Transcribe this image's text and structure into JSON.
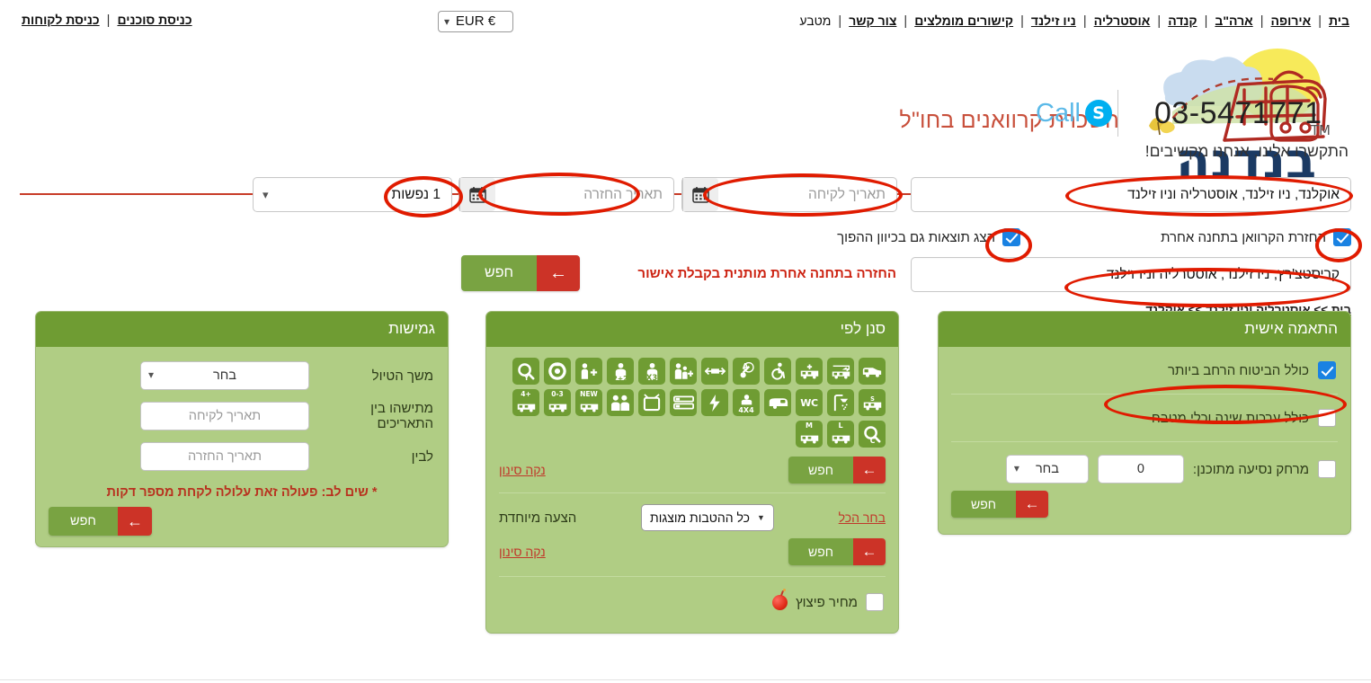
{
  "topbar": {
    "left_links": [
      "כניסת סוכנים",
      "כניסת לקוחות"
    ],
    "currency_label": "מטבע",
    "currency_value": "EUR €",
    "nav_links": [
      "בית",
      "אירופה",
      "ארה\"ב",
      "קנדה",
      "אוסטרליה",
      "ניו זילנד",
      "קישורים מומלצים",
      "צור קשר"
    ]
  },
  "header": {
    "site_title": "השכרת קרוואנים בחו\"ל",
    "skype_label": "Call",
    "skype_badge": "S",
    "phone": "03-5471771",
    "tagline": "התקשרו אלינו, אנחנו מקשיבים!",
    "logo_text": "בנדנה",
    "logo_tm": "TM"
  },
  "search": {
    "pickup_location_value": "אוקלנד, ניו זילנד, אוסטרליה וניו זילנד",
    "pickup_date_placeholder": "תאריך לקיחה",
    "return_date_placeholder": "תאריך החזרה",
    "persons_value": "1 נפשות",
    "different_return_label": "החזרת הקרוואן בתחנה אחרת",
    "reverse_results_label": "הצג תוצאות גם בכיוון ההפוך",
    "return_location_value": "קריסטצ'רץ, ניו זילנד, אוסטרליה וניו זילנד",
    "return_note": "החזרה בתחנה אחרת מותנית בקבלת אישור",
    "search_button": "חפש",
    "breadcrumb": [
      "בית",
      "אוסטרליה וניו זילנד",
      "אוקלנד"
    ],
    "breadcrumb_sep": ">>"
  },
  "flexibility_panel": {
    "title": "גמישות",
    "trip_duration_label": "משך הטיול",
    "trip_duration_value": "בחר",
    "between_dates_label": "מתישהו בין התאריכים",
    "between_dates_placeholder": "תאריך לקיחה",
    "to_label": "לבין",
    "to_placeholder": "תאריך החזרה",
    "warning": "* שים לב: פעולה זאת עלולה לקחת מספר דקות",
    "search_button": "חפש"
  },
  "filter_panel": {
    "title": "סנן לפי",
    "clear_filter_1": "נקה סינון",
    "clear_filter_2": "נקה סינון",
    "search_button_1": "חפש",
    "search_button_2": "חפש",
    "special_offer_label": "הצעה מיוחדת",
    "special_offer_value": "כל ההטבות מוצגות",
    "select_all_link": "בחר הכל",
    "blast_price_label": "מחיר פיצוץ",
    "icons": [
      {
        "name": "campervan-icon",
        "tag": ""
      },
      {
        "name": "motorhome-arrow-icon",
        "tag": ""
      },
      {
        "name": "motorhome-plus-icon",
        "tag": ""
      },
      {
        "name": "wheelchair-accessible-icon",
        "tag": ""
      },
      {
        "name": "automatic-transmission-icon",
        "tag": "A"
      },
      {
        "name": "length-icon",
        "tag": ""
      },
      {
        "name": "family-plus-icon",
        "tag": ""
      },
      {
        "name": "passengers-x3-icon",
        "tag": "X3"
      },
      {
        "name": "passengers-2plus2-icon",
        "tag": "2+2"
      },
      {
        "name": "child-seat-icon",
        "tag": ""
      },
      {
        "name": "oneway-icon",
        "tag": ""
      },
      {
        "name": "search-y-icon",
        "tag": "Y"
      },
      {
        "name": "motorhome-s-icon",
        "tag": "S"
      },
      {
        "name": "shower-icon",
        "tag": ""
      },
      {
        "name": "wc-icon",
        "tag": "WC"
      },
      {
        "name": "caravan-trailer-icon",
        "tag": ""
      },
      {
        "name": "four-by-four-icon",
        "tag": "4X4"
      },
      {
        "name": "electricity-icon",
        "tag": ""
      },
      {
        "name": "bunk-bed-icon",
        "tag": ""
      },
      {
        "name": "television-icon",
        "tag": ""
      },
      {
        "name": "group-icon",
        "tag": ""
      },
      {
        "name": "new-vehicle-icon",
        "tag": "NEW"
      },
      {
        "name": "motorhome-0-3-icon",
        "tag": "0-3"
      },
      {
        "name": "motorhome-plus4-icon",
        "tag": "+4"
      },
      {
        "name": "search-c-icon",
        "tag": "C"
      },
      {
        "name": "motorhome-l-icon",
        "tag": "L"
      },
      {
        "name": "motorhome-m-icon",
        "tag": "M"
      }
    ]
  },
  "personalize_panel": {
    "title": "התאמה אישית",
    "full_insurance_label": "כולל הביטוח הרחב ביותר",
    "full_insurance_checked": true,
    "bedding_kitchen_label": "כולל ערכות שינה וכלי מטבח",
    "bedding_kitchen_checked": false,
    "distance_label": "מרחק נסיעה מתוכנן:",
    "distance_checked": false,
    "distance_value": "0",
    "distance_unit_value": "בחר",
    "search_button": "חפש"
  },
  "icons": {
    "calendar": "calendar-icon",
    "chevron_down": "chevron-down-icon",
    "arrow_left": "arrow-left-icon"
  },
  "colors": {
    "panel_header_green": "#6f9c33",
    "panel_body_green": "#b0cd84",
    "search_green": "#79a342",
    "search_red": "#cc3327",
    "accent_red": "#c83c28",
    "checkbox_blue": "#1a82e2",
    "annotation_red": "#e01b00",
    "link_red": "#c0392b"
  }
}
